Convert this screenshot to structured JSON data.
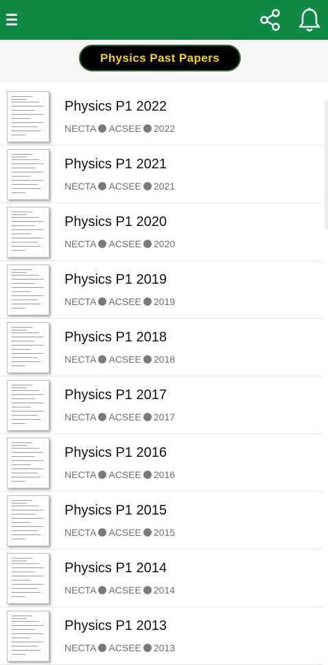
{
  "app": {
    "title": "Physics Past Papers",
    "accent": "#0f8a44",
    "title_text_color": "#f3d20e"
  },
  "toolbar": {
    "menu_icon": "hamburger-menu-icon",
    "share_icon": "share-icon",
    "notification_icon": "bell-icon"
  },
  "papers": [
    {
      "title": "Physics P1 2022",
      "exam": "NECTA",
      "level": "ACSEE",
      "year": "2022"
    },
    {
      "title": "Physics P1 2021",
      "exam": "NECTA",
      "level": "ACSEE",
      "year": "2021"
    },
    {
      "title": "Physics P1 2020",
      "exam": "NECTA",
      "level": "ACSEE",
      "year": "2020"
    },
    {
      "title": "Physics P1 2019",
      "exam": "NECTA",
      "level": "ACSEE",
      "year": "2019"
    },
    {
      "title": "Physics P1 2018",
      "exam": "NECTA",
      "level": "ACSEE",
      "year": "2018"
    },
    {
      "title": "Physics P1 2017",
      "exam": "NECTA",
      "level": "ACSEE",
      "year": "2017"
    },
    {
      "title": "Physics P1 2016",
      "exam": "NECTA",
      "level": "ACSEE",
      "year": "2016"
    },
    {
      "title": "Physics P1 2015",
      "exam": "NECTA",
      "level": "ACSEE",
      "year": "2015"
    },
    {
      "title": "Physics P1 2014",
      "exam": "NECTA",
      "level": "ACSEE",
      "year": "2014"
    },
    {
      "title": "Physics P1 2013",
      "exam": "NECTA",
      "level": "ACSEE",
      "year": "2013"
    }
  ]
}
